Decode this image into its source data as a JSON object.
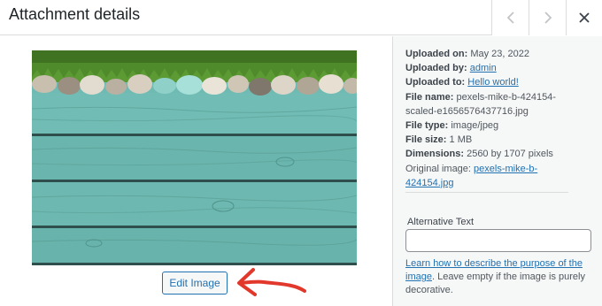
{
  "header": {
    "title": "Attachment details",
    "prev_icon": "chevron-left-icon",
    "next_icon": "chevron-right-icon",
    "close_icon": "close-icon"
  },
  "media": {
    "image_alt": "Teal wooden planks with grass and pebbles border",
    "edit_button": "Edit Image",
    "annotation": "red-arrow-pointing-left"
  },
  "details": {
    "uploaded_on_label": "Uploaded on:",
    "uploaded_on": "May 23, 2022",
    "uploaded_by_label": "Uploaded by:",
    "uploaded_by": "admin",
    "uploaded_to_label": "Uploaded to:",
    "uploaded_to": "Hello world!",
    "file_name_label": "File name:",
    "file_name_line1": "pexels-mike-b-424154-",
    "file_name_line2": "scaled-e1656576437716.jpg",
    "file_type_label": "File type:",
    "file_type": "image/jpeg",
    "file_size_label": "File size:",
    "file_size": "1 MB",
    "dimensions_label": "Dimensions:",
    "dimensions": "2560 by 1707 pixels",
    "original_label": "Original image:",
    "original_line1": "pexels-mike-b-",
    "original_line2": "424154.jpg"
  },
  "alt_text": {
    "label": "Alternative Text",
    "value": "",
    "help_link": "Learn how to describe the purpose of the image",
    "help_rest": ". Leave empty if the image is purely decorative."
  },
  "colors": {
    "link": "#2271b1",
    "border": "#dcdcde",
    "sidebar_bg": "#f6f7f7",
    "arrow": "#e2382c",
    "wood": "#6cb8b1"
  }
}
